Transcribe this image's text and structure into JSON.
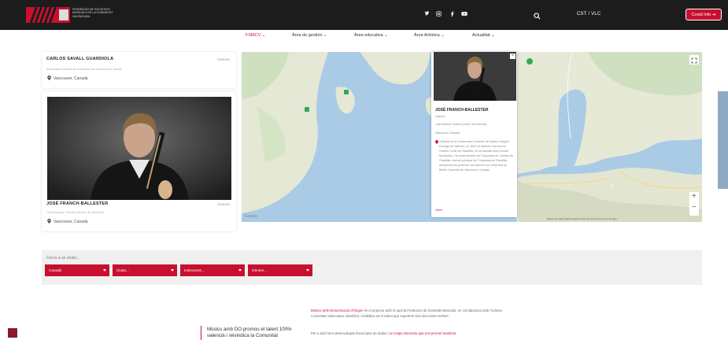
{
  "header": {
    "org_name": "FEDERACIÓ DE SOCIETATS MUSICALS DE LA COMUNITAT VALENCIANA",
    "social_icons": [
      "twitter-icon",
      "instagram-icon",
      "facebook-icon",
      "youtube-icon"
    ],
    "language": "CST / VLC",
    "covid_button": "Covid Info ➔"
  },
  "nav": {
    "items": [
      {
        "label": "FSMCV ⌄",
        "active": true
      },
      {
        "label": "Àrea de gestión ⌄",
        "active": false
      },
      {
        "label": "Àrea educativa ⌄",
        "active": false
      },
      {
        "label": "Àrea Artística ⌄",
        "active": false
      },
      {
        "label": "Actualitat ⌄",
        "active": false
      }
    ]
  },
  "cards": [
    {
      "name": "CARLOS SAVALL GUARDIOLA",
      "role": "Clarinet",
      "society": "Associació Afinats de la Música de Calosa d'en Sarrià",
      "location": "Vancouver, Canada"
    },
    {
      "name": "JOSÉ FRANCH-BALLESTER",
      "role": "Clarinet",
      "society": "Unió Musical \"Santa Cecília\" de Moncofa",
      "location": "Vancouver, Canada"
    }
  ],
  "map": {
    "popup": {
      "name": "JOSÉ FRANCH-BALLESTER",
      "role": "Clarinet",
      "society": "Unió Musical \"Santa Cecília\" de Moncofa",
      "location": "Vancouver, Canadà",
      "bio": "Graduat en el Conservatori Superior de Música Joaquín Rodrigo de València, en 2000 va obtindre una beca a l'Institut Curtis de Filadèlfia, on va estudiar amb Donald Montanaro. Ha estat membre de l'Orquestra de Cambra de Filadèlfia, clarinet principal de l'Orquestra de Filadèlfia. Actualment és professor de clarinet a la Universitat de British Columbia de Vancouver, Canadà.",
      "link": "Veure"
    },
    "attribution": "Dades del mapa ©2021 Google  Termes d'ús  Informa d'un error al mapa",
    "zoom_in": "+",
    "zoom_out": "−"
  },
  "filters": {
    "label": "Cerca a un músic...",
    "selects": [
      "Canadà",
      "Ciutat...",
      "Instrument...",
      "Gènere..."
    ]
  },
  "bottom": {
    "headline": "Músics amb DO promou el talent 100% valencià i reivindica la Comunitat",
    "para1_highlight": "Músics amb Denominació d'Origen",
    "para1_rest": " és el projecte amb el qual la Federació de Societats Musicals, en col·laboració amb Turisme Comunitat Valenciana, identifica i visibilitza tot el talent que exportem fora del nostre territori.",
    "para2": "Per a això hem desenvolupat d'una base de dades i ",
    "para2_link": "un mapa interactiu que ens permet localitzar"
  },
  "colors": {
    "accent": "#c8102e",
    "topbar": "#1c1c1c",
    "water": "#a9cde8",
    "land": "#e8ead7"
  }
}
